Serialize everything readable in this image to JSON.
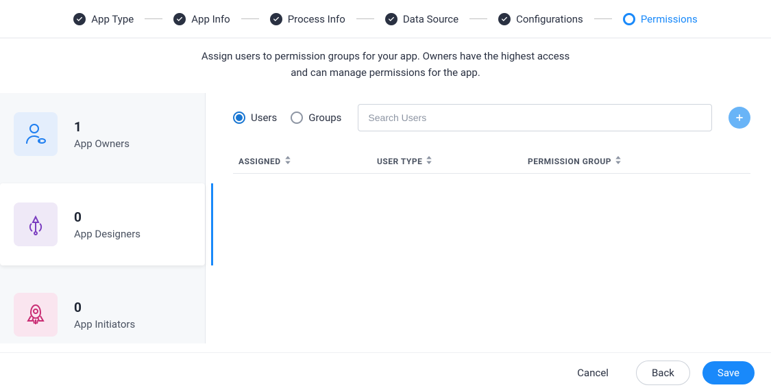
{
  "stepper": {
    "steps": [
      {
        "label": "App Type",
        "state": "done"
      },
      {
        "label": "App Info",
        "state": "done"
      },
      {
        "label": "Process Info",
        "state": "done"
      },
      {
        "label": "Data Source",
        "state": "done"
      },
      {
        "label": "Configurations",
        "state": "done"
      },
      {
        "label": "Permissions",
        "state": "current"
      }
    ]
  },
  "description": {
    "line1": "Assign users to permission groups for your app. Owners have the highest access",
    "line2": "and can manage permissions for the app."
  },
  "sidebar": {
    "cards": [
      {
        "count": "1",
        "label": "App Owners",
        "icon": "owner-icon",
        "selected": false
      },
      {
        "count": "0",
        "label": "App Designers",
        "icon": "designer-icon",
        "selected": true
      },
      {
        "count": "0",
        "label": "App Initiators",
        "icon": "initiator-icon",
        "selected": false
      }
    ]
  },
  "toolbar": {
    "radios": [
      {
        "label": "Users",
        "selected": true
      },
      {
        "label": "Groups",
        "selected": false
      }
    ],
    "search_placeholder": "Search Users",
    "add_label": "Add"
  },
  "table": {
    "columns": [
      {
        "label": "ASSIGNED"
      },
      {
        "label": "USER TYPE"
      },
      {
        "label": "PERMISSION GROUP"
      }
    ],
    "rows": []
  },
  "footer": {
    "cancel": "Cancel",
    "back": "Back",
    "save": "Save"
  }
}
